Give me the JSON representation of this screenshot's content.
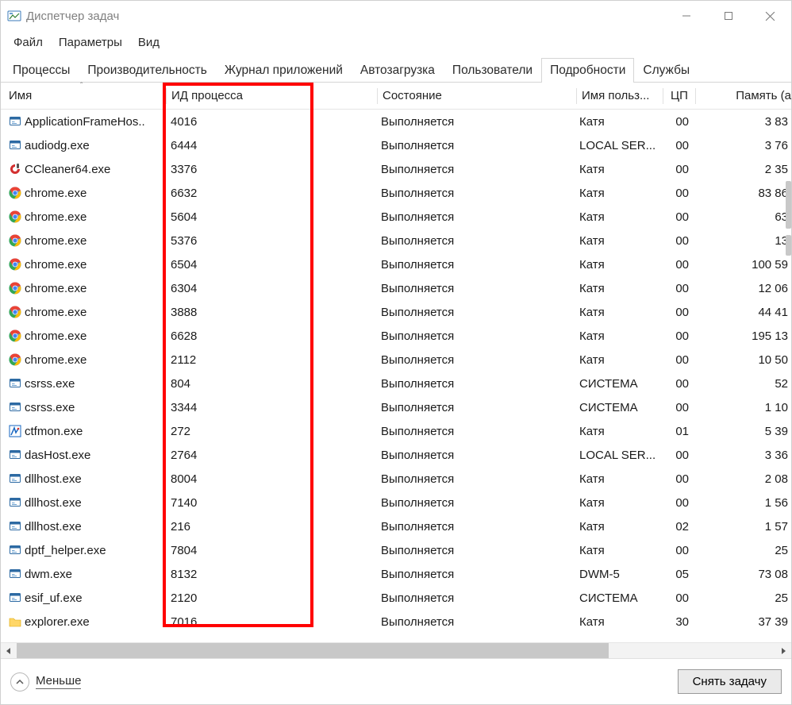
{
  "window": {
    "title": "Диспетчер задач"
  },
  "menu": {
    "file": "Файл",
    "options": "Параметры",
    "view": "Вид"
  },
  "tabs": {
    "items": [
      {
        "label": "Процессы",
        "active": false
      },
      {
        "label": "Производительность",
        "active": false
      },
      {
        "label": "Журнал приложений",
        "active": false
      },
      {
        "label": "Автозагрузка",
        "active": false
      },
      {
        "label": "Пользователи",
        "active": false
      },
      {
        "label": "Подробности",
        "active": true
      },
      {
        "label": "Службы",
        "active": false
      }
    ]
  },
  "table": {
    "headers": {
      "name": "Имя",
      "pid": "ИД процесса",
      "state": "Состояние",
      "user": "Имя польз...",
      "cpu": "ЦП",
      "mem": "Память (а"
    },
    "sort_col": "name",
    "rows": [
      {
        "icon": "exe",
        "name": "ApplicationFrameHos..",
        "pid": "4016",
        "state": "Выполняется",
        "user": "Катя",
        "cpu": "00",
        "mem": "3 83"
      },
      {
        "icon": "exe",
        "name": "audiodg.exe",
        "pid": "6444",
        "state": "Выполняется",
        "user": "LOCAL SER...",
        "cpu": "00",
        "mem": "3 76"
      },
      {
        "icon": "ccleaner",
        "name": "CCleaner64.exe",
        "pid": "3376",
        "state": "Выполняется",
        "user": "Катя",
        "cpu": "00",
        "mem": "2 35"
      },
      {
        "icon": "chrome",
        "name": "chrome.exe",
        "pid": "6632",
        "state": "Выполняется",
        "user": "Катя",
        "cpu": "00",
        "mem": "83 86"
      },
      {
        "icon": "chrome",
        "name": "chrome.exe",
        "pid": "5604",
        "state": "Выполняется",
        "user": "Катя",
        "cpu": "00",
        "mem": "63"
      },
      {
        "icon": "chrome",
        "name": "chrome.exe",
        "pid": "5376",
        "state": "Выполняется",
        "user": "Катя",
        "cpu": "00",
        "mem": "13"
      },
      {
        "icon": "chrome",
        "name": "chrome.exe",
        "pid": "6504",
        "state": "Выполняется",
        "user": "Катя",
        "cpu": "00",
        "mem": "100 59"
      },
      {
        "icon": "chrome",
        "name": "chrome.exe",
        "pid": "6304",
        "state": "Выполняется",
        "user": "Катя",
        "cpu": "00",
        "mem": "12 06"
      },
      {
        "icon": "chrome",
        "name": "chrome.exe",
        "pid": "3888",
        "state": "Выполняется",
        "user": "Катя",
        "cpu": "00",
        "mem": "44 41"
      },
      {
        "icon": "chrome",
        "name": "chrome.exe",
        "pid": "6628",
        "state": "Выполняется",
        "user": "Катя",
        "cpu": "00",
        "mem": "195 13"
      },
      {
        "icon": "chrome",
        "name": "chrome.exe",
        "pid": "2112",
        "state": "Выполняется",
        "user": "Катя",
        "cpu": "00",
        "mem": "10 50"
      },
      {
        "icon": "exe",
        "name": "csrss.exe",
        "pid": "804",
        "state": "Выполняется",
        "user": "СИСТЕМА",
        "cpu": "00",
        "mem": "52"
      },
      {
        "icon": "exe",
        "name": "csrss.exe",
        "pid": "3344",
        "state": "Выполняется",
        "user": "СИСТЕМА",
        "cpu": "00",
        "mem": "1 10"
      },
      {
        "icon": "ctfmon",
        "name": "ctfmon.exe",
        "pid": "272",
        "state": "Выполняется",
        "user": "Катя",
        "cpu": "01",
        "mem": "5 39"
      },
      {
        "icon": "exe",
        "name": "dasHost.exe",
        "pid": "2764",
        "state": "Выполняется",
        "user": "LOCAL SER...",
        "cpu": "00",
        "mem": "3 36"
      },
      {
        "icon": "exe",
        "name": "dllhost.exe",
        "pid": "8004",
        "state": "Выполняется",
        "user": "Катя",
        "cpu": "00",
        "mem": "2 08"
      },
      {
        "icon": "exe",
        "name": "dllhost.exe",
        "pid": "7140",
        "state": "Выполняется",
        "user": "Катя",
        "cpu": "00",
        "mem": "1 56"
      },
      {
        "icon": "exe",
        "name": "dllhost.exe",
        "pid": "216",
        "state": "Выполняется",
        "user": "Катя",
        "cpu": "02",
        "mem": "1 57"
      },
      {
        "icon": "exe",
        "name": "dptf_helper.exe",
        "pid": "7804",
        "state": "Выполняется",
        "user": "Катя",
        "cpu": "00",
        "mem": "25"
      },
      {
        "icon": "exe",
        "name": "dwm.exe",
        "pid": "8132",
        "state": "Выполняется",
        "user": "DWM-5",
        "cpu": "05",
        "mem": "73 08"
      },
      {
        "icon": "exe",
        "name": "esif_uf.exe",
        "pid": "2120",
        "state": "Выполняется",
        "user": "СИСТЕМА",
        "cpu": "00",
        "mem": "25"
      },
      {
        "icon": "folder",
        "name": "explorer.exe",
        "pid": "7016",
        "state": "Выполняется",
        "user": "Катя",
        "cpu": "30",
        "mem": "37 39"
      }
    ]
  },
  "highlight": {
    "pid_box": true
  },
  "footer": {
    "less_label": "Меньше",
    "end_task_label": "Снять задачу"
  }
}
